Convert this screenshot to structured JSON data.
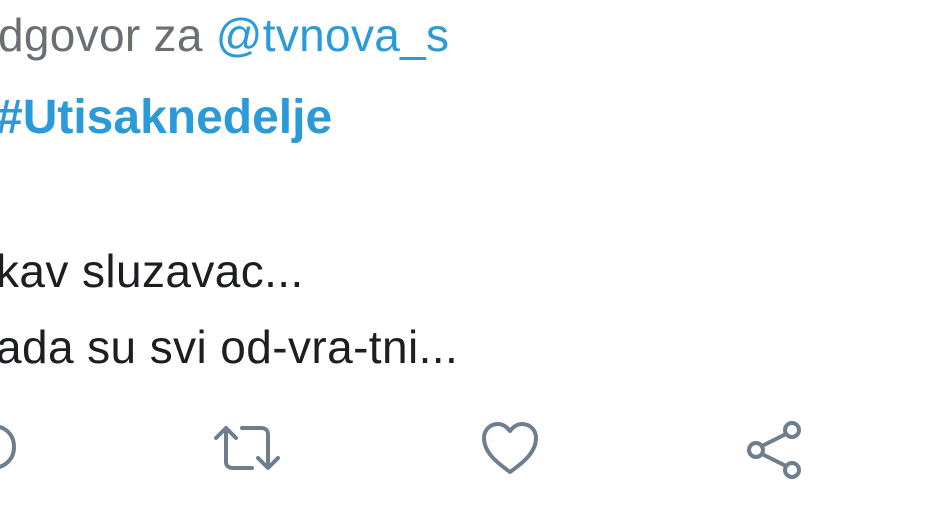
{
  "tweet": {
    "reply_prefix": "dgovor za ",
    "reply_mention": "@tvnova_s",
    "hashtag": "#Utisaknedelje",
    "text_lines": [
      "kav sluzavac...",
      "ada su svi od-vra-tni..."
    ]
  },
  "actions": {
    "icons": [
      "reply-icon",
      "retweet-icon",
      "like-icon",
      "share-icon"
    ]
  },
  "colors": {
    "accent": "#2b9ad8",
    "muted_text": "#6b6f73",
    "body_text": "#1c1e21",
    "icon": "#6f7e8c",
    "background": "#ffffff"
  }
}
